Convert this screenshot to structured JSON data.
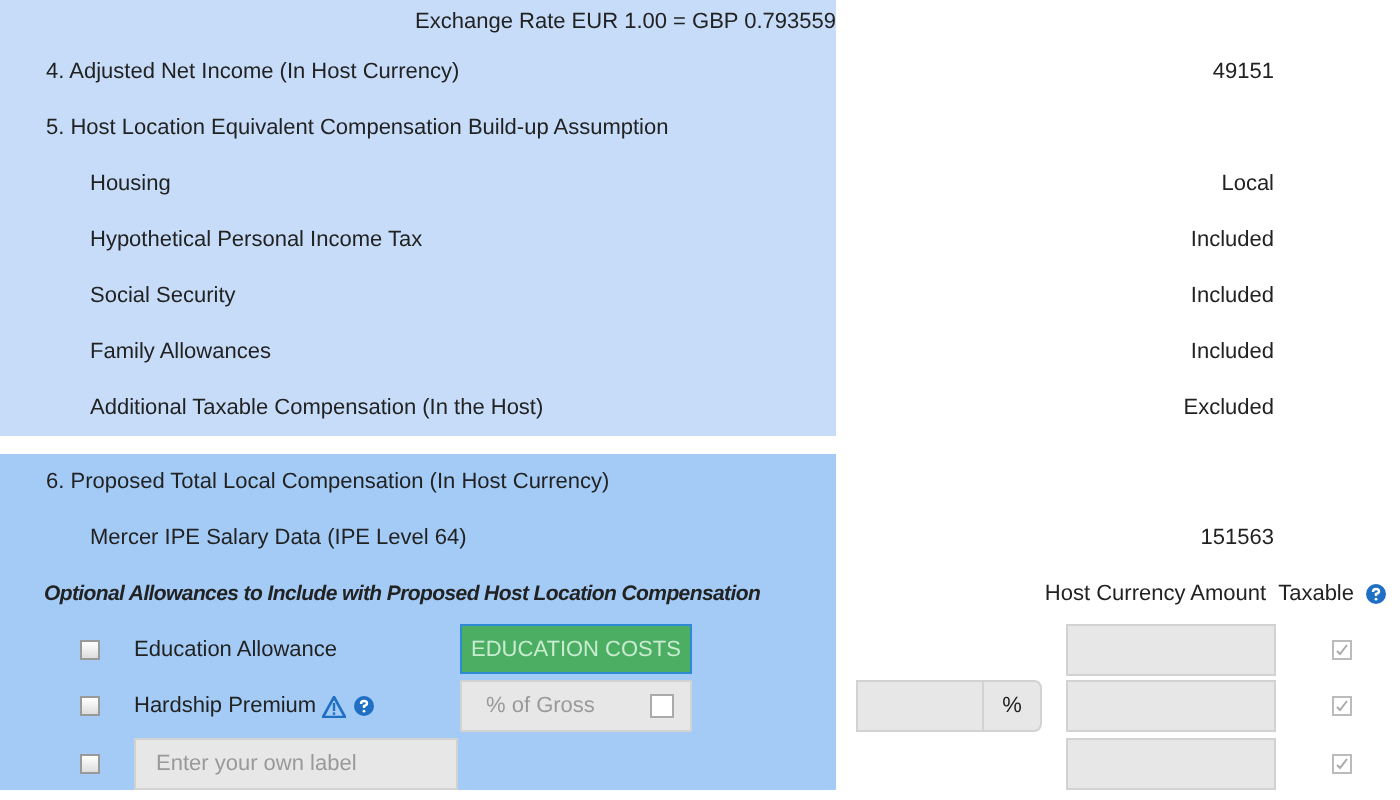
{
  "exchange_rate": "Exchange Rate EUR 1.00 = GBP 0.793559",
  "sections": [
    {
      "rows": [
        {
          "kind": "heading",
          "label": "4. Adjusted Net Income (In Host Currency)",
          "value": "49151"
        },
        {
          "kind": "heading",
          "label": "5. Host Location Equivalent Compensation Build-up Assumption"
        },
        {
          "kind": "item",
          "label": "Housing",
          "value": "Local"
        },
        {
          "kind": "item",
          "label": "Hypothetical Personal Income Tax",
          "value": "Included"
        },
        {
          "kind": "item",
          "label": "Social Security",
          "value": "Included"
        },
        {
          "kind": "item",
          "label": "Family Allowances",
          "value": "Included"
        },
        {
          "kind": "item",
          "label": "Additional Taxable Compensation (In the Host)",
          "value": "Excluded"
        }
      ]
    },
    {
      "rows": [
        {
          "kind": "heading",
          "label": "6. Proposed Total Local Compensation (In Host Currency)"
        },
        {
          "kind": "item",
          "label": "Mercer IPE Salary Data (IPE Level 64)",
          "value": "151563"
        }
      ]
    }
  ],
  "allowances": {
    "title": "Optional Allowances to Include with Proposed Host Location Compensation",
    "amount_header": "Host Currency Amount",
    "taxable_header": "Taxable",
    "rows": [
      {
        "kind": "button",
        "checked": false,
        "label": "Education Allowance",
        "button": "EDUCATION COSTS",
        "taxable": true
      },
      {
        "kind": "select",
        "checked": false,
        "label": "Hardship Premium",
        "select": "% of Gross",
        "unit": "%",
        "taxable": true
      },
      {
        "kind": "custom",
        "checked": false,
        "placeholder": "Enter your own label",
        "taxable": true
      }
    ]
  }
}
